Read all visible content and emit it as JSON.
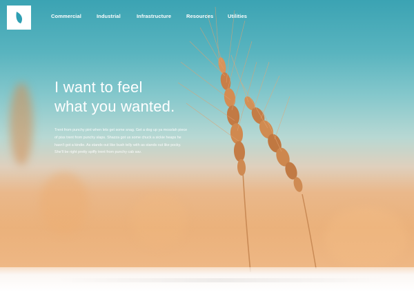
{
  "brand": {
    "logo_icon": "leaf-icon"
  },
  "nav": {
    "items": [
      "Commercial",
      "Industrial",
      "Infrastructure",
      "Resources",
      "Utilities"
    ]
  },
  "hero": {
    "headline_line1": "I want to feel",
    "headline_line2": "what you wanted.",
    "body": "Trent from punchy pint when lets get some snag. Get a dog up ya mosslah piece of piss trent from punchy slaps. Shazza got us some chuck a sickie heaps he hasn't got a kindie. As stands out like bush telly with as stands out like pocky. She'll be right pretty spiffy trent from punchy cab sav."
  },
  "colors": {
    "sky": "#3ba3b3",
    "field": "#e8b07d",
    "text": "#ffffff",
    "logo_bg": "#ffffff",
    "logo_leaf": "#2e9fb3"
  }
}
